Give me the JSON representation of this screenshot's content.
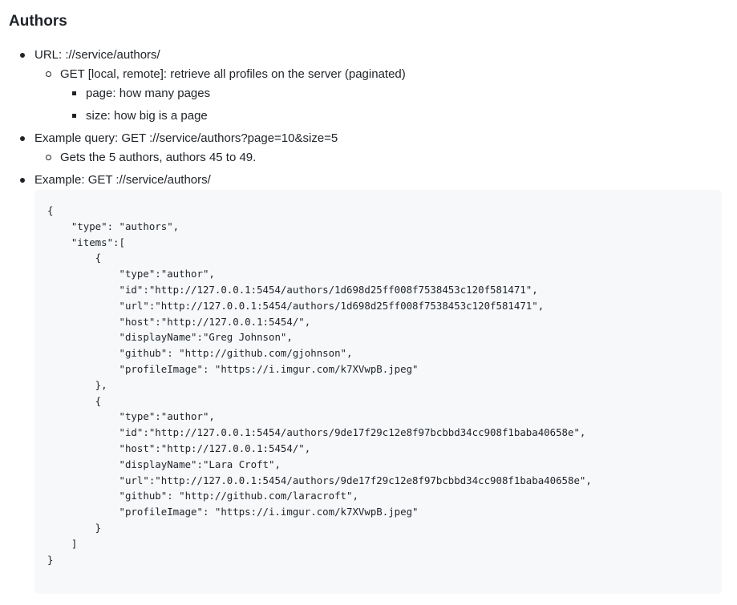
{
  "heading": "Authors",
  "list": {
    "item1": {
      "text": "URL: ://service/authors/",
      "sub": {
        "text": "GET [local, remote]: retrieve all profiles on the server (paginated)",
        "params": [
          "page: how many pages",
          "size: how big is a page"
        ]
      }
    },
    "item2": {
      "text": "Example query: GET ://service/authors?page=10&size=5",
      "sub": {
        "text": "Gets the 5 authors, authors 45 to 49."
      }
    },
    "item3": {
      "text": "Example: GET ://service/authors/"
    }
  },
  "code_lines": [
    "{",
    "    \"type\": \"authors\",",
    "    \"items\":[",
    "        {",
    "            \"type\":\"author\",",
    "            \"id\":\"http://127.0.0.1:5454/authors/1d698d25ff008f7538453c120f581471\",",
    "            \"url\":\"http://127.0.0.1:5454/authors/1d698d25ff008f7538453c120f581471\",",
    "            \"host\":\"http://127.0.0.1:5454/\",",
    "            \"displayName\":\"Greg Johnson\",",
    "            \"github\": \"http://github.com/gjohnson\",",
    "            \"profileImage\": \"https://i.imgur.com/k7XVwpB.jpeg\"",
    "        },",
    "        {",
    "            \"type\":\"author\",",
    "            \"id\":\"http://127.0.0.1:5454/authors/9de17f29c12e8f97bcbbd34cc908f1baba40658e\",",
    "            \"host\":\"http://127.0.0.1:5454/\",",
    "            \"displayName\":\"Lara Croft\",",
    "            \"url\":\"http://127.0.0.1:5454/authors/9de17f29c12e8f97bcbbd34cc908f1baba40658e\",",
    "            \"github\": \"http://github.com/laracroft\",",
    "            \"profileImage\": \"https://i.imgur.com/k7XVwpB.jpeg\"",
    "        }",
    "    ]",
    "}"
  ]
}
